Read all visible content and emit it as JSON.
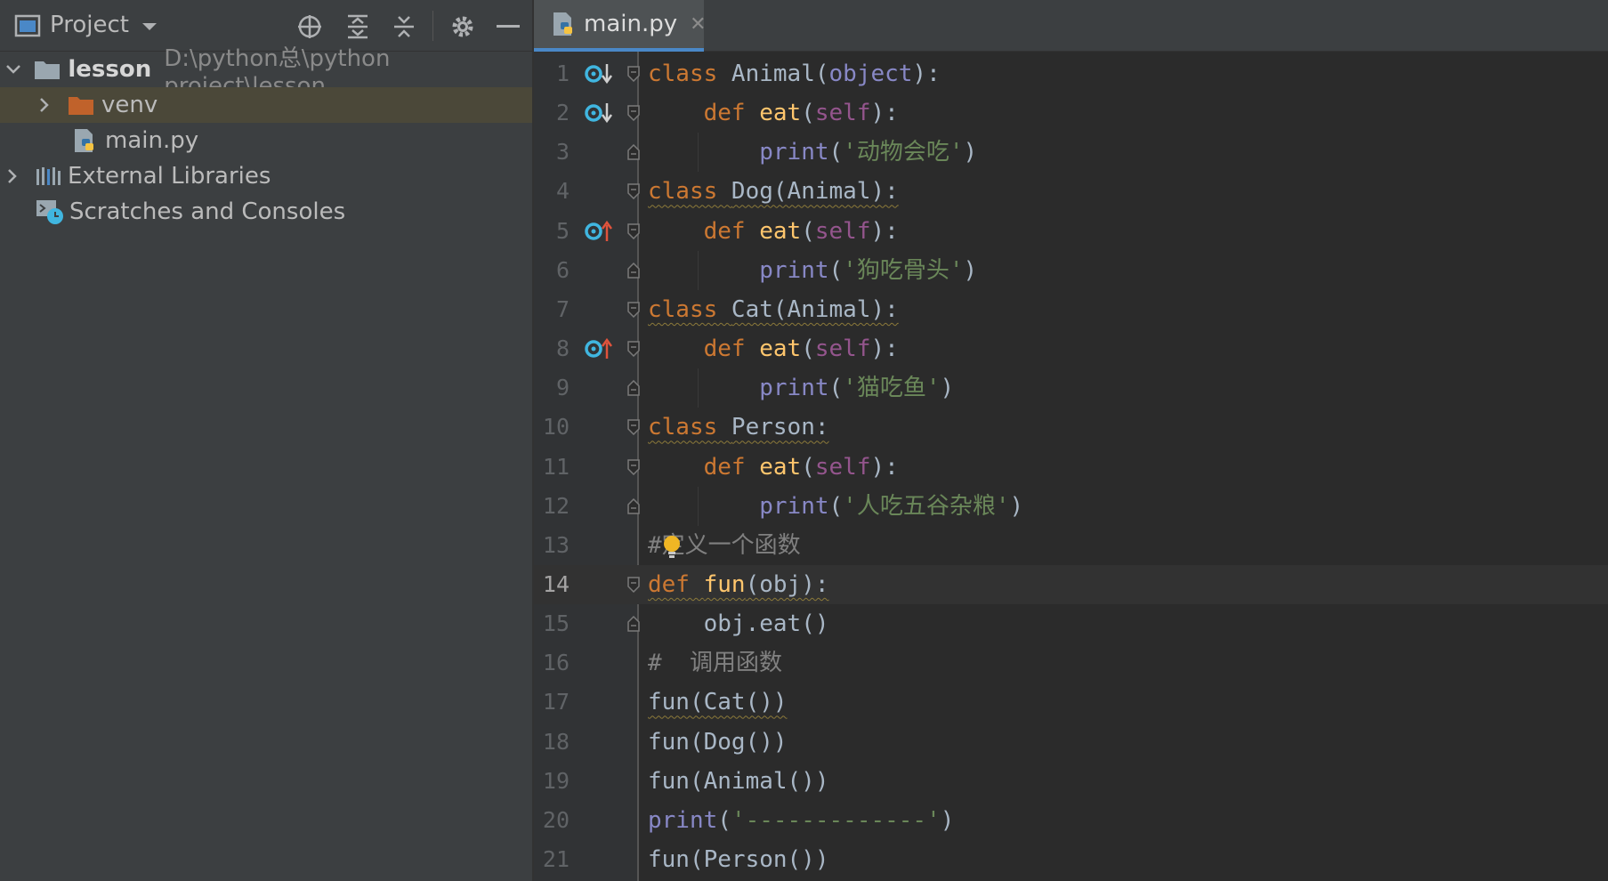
{
  "project_panel": {
    "title": "Project",
    "tree": {
      "root_name": "lesson",
      "root_path": "D:\\python总\\python project\\lesson",
      "venv": "venv",
      "main_file": "main.py",
      "external_libraries": "External Libraries",
      "scratches": "Scratches and Consoles"
    }
  },
  "editor": {
    "tab_label": "main.py",
    "tab_close": "✕",
    "current_line": 14,
    "lines": [
      {
        "n": "1",
        "t": [
          [
            "kw",
            "class "
          ],
          [
            "plain",
            "Animal("
          ],
          [
            "bi",
            "object"
          ],
          [
            "plain",
            "):"
          ]
        ]
      },
      {
        "n": "2",
        "t": [
          [
            "sp",
            "    "
          ],
          [
            "kw",
            "def "
          ],
          [
            "fn",
            "eat"
          ],
          [
            "plain",
            "("
          ],
          [
            "selfc",
            "self"
          ],
          [
            "plain",
            "):"
          ]
        ]
      },
      {
        "n": "3",
        "t": [
          [
            "sp",
            "        "
          ],
          [
            "bi",
            "print"
          ],
          [
            "plain",
            "("
          ],
          [
            "str",
            "'动物会吃'"
          ],
          [
            "plain",
            ")"
          ]
        ]
      },
      {
        "n": "4",
        "t": [
          [
            "kw",
            "class "
          ],
          [
            "plain",
            "Dog(Animal):"
          ]
        ]
      },
      {
        "n": "5",
        "t": [
          [
            "sp",
            "    "
          ],
          [
            "kw",
            "def "
          ],
          [
            "fn",
            "eat"
          ],
          [
            "plain",
            "("
          ],
          [
            "selfc",
            "self"
          ],
          [
            "plain",
            "):"
          ]
        ]
      },
      {
        "n": "6",
        "t": [
          [
            "sp",
            "        "
          ],
          [
            "bi",
            "print"
          ],
          [
            "plain",
            "("
          ],
          [
            "str",
            "'狗吃骨头'"
          ],
          [
            "plain",
            ")"
          ]
        ]
      },
      {
        "n": "7",
        "t": [
          [
            "kw",
            "class "
          ],
          [
            "plain",
            "Cat(Animal):"
          ]
        ]
      },
      {
        "n": "8",
        "t": [
          [
            "sp",
            "    "
          ],
          [
            "kw",
            "def "
          ],
          [
            "fn",
            "eat"
          ],
          [
            "plain",
            "("
          ],
          [
            "selfc",
            "self"
          ],
          [
            "plain",
            "):"
          ]
        ]
      },
      {
        "n": "9",
        "t": [
          [
            "sp",
            "        "
          ],
          [
            "bi",
            "print"
          ],
          [
            "plain",
            "("
          ],
          [
            "str",
            "'猫吃鱼'"
          ],
          [
            "plain",
            ")"
          ]
        ]
      },
      {
        "n": "10",
        "t": [
          [
            "kw",
            "class "
          ],
          [
            "plain",
            "Person:"
          ]
        ]
      },
      {
        "n": "11",
        "t": [
          [
            "sp",
            "    "
          ],
          [
            "kw",
            "def "
          ],
          [
            "fn",
            "eat"
          ],
          [
            "plain",
            "("
          ],
          [
            "selfc",
            "self"
          ],
          [
            "plain",
            "):"
          ]
        ]
      },
      {
        "n": "12",
        "t": [
          [
            "sp",
            "        "
          ],
          [
            "bi",
            "print"
          ],
          [
            "plain",
            "("
          ],
          [
            "str",
            "'人吃五谷杂粮'"
          ],
          [
            "plain",
            ")"
          ]
        ]
      },
      {
        "n": "13",
        "t": [
          [
            "cmt",
            "#定义一个函数"
          ]
        ]
      },
      {
        "n": "14",
        "t": [
          [
            "kw",
            "def "
          ],
          [
            "fn",
            "fun"
          ],
          [
            "plain",
            "(obj):"
          ]
        ]
      },
      {
        "n": "15",
        "t": [
          [
            "sp",
            "    "
          ],
          [
            "plain",
            "obj.eat()"
          ]
        ]
      },
      {
        "n": "16",
        "t": [
          [
            "cmt",
            "#  调用函数"
          ]
        ]
      },
      {
        "n": "17",
        "t": [
          [
            "plain",
            "fun(Cat())"
          ]
        ]
      },
      {
        "n": "18",
        "t": [
          [
            "plain",
            "fun(Dog())"
          ]
        ]
      },
      {
        "n": "19",
        "t": [
          [
            "plain",
            "fun(Animal())"
          ]
        ]
      },
      {
        "n": "20",
        "t": [
          [
            "bi",
            "print"
          ],
          [
            "plain",
            "("
          ],
          [
            "str",
            "'-------------'"
          ],
          [
            "plain",
            ")"
          ]
        ]
      },
      {
        "n": "21",
        "t": [
          [
            "plain",
            "fun(Person())"
          ]
        ]
      }
    ]
  },
  "colors": {
    "keyword": "#cc7832",
    "function": "#ffc66d",
    "string": "#6a8759",
    "builtin": "#8888c6",
    "self": "#94558d",
    "comment": "#808080",
    "accent": "#4a88c7"
  }
}
